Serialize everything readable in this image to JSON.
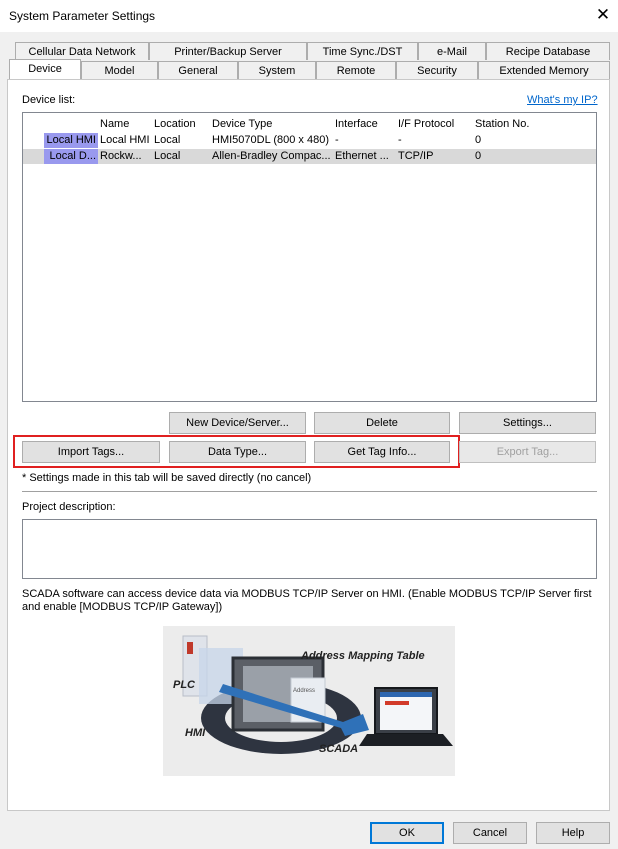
{
  "window": {
    "title": "System Parameter Settings",
    "close_glyph": "✕"
  },
  "tabs_row1": [
    "Cellular Data Network",
    "Printer/Backup Server",
    "Time Sync./DST",
    "e-Mail",
    "Recipe Database"
  ],
  "tabs_row2": [
    "Device",
    "Model",
    "General",
    "System",
    "Remote",
    "Security",
    "Extended Memory"
  ],
  "device": {
    "list_label": "Device list:",
    "whats_my_ip": "What's my IP?",
    "columns": [
      "Name",
      "Location",
      "Device Type",
      "Interface",
      "I/F Protocol",
      "Station No."
    ],
    "rows": [
      {
        "head": "Local HMI",
        "cells": [
          "Local HMI",
          "Local",
          "HMI5070DL (800 x 480)",
          "-",
          "-",
          "0"
        ],
        "selected": false
      },
      {
        "head": "Local D...",
        "cells": [
          "Rockw...",
          "Local",
          "Allen-Bradley Compac...",
          "Ethernet ...",
          "TCP/IP",
          "0"
        ],
        "selected": true
      }
    ],
    "buttons_row1": {
      "new_device": "New Device/Server...",
      "delete": "Delete",
      "settings": "Settings..."
    },
    "buttons_row2": {
      "import_tags": "Import Tags...",
      "data_type": "Data Type...",
      "get_tag_info": "Get Tag Info...",
      "export_tag": "Export Tag..."
    },
    "note": "* Settings made in this tab will be saved directly (no cancel)",
    "project_description_label": "Project description:",
    "project_description_value": "",
    "scada_text": "SCADA software can access device data via MODBUS TCP/IP Server on HMI. (Enable MODBUS TCP/IP Server first and enable [MODBUS TCP/IP Gateway])",
    "illustration": {
      "title": "Address Mapping Table",
      "plc": "PLC",
      "hmi": "HMI",
      "scada": "SCADA",
      "badge": "Address"
    }
  },
  "footer": {
    "ok": "OK",
    "cancel": "Cancel",
    "help": "Help"
  }
}
